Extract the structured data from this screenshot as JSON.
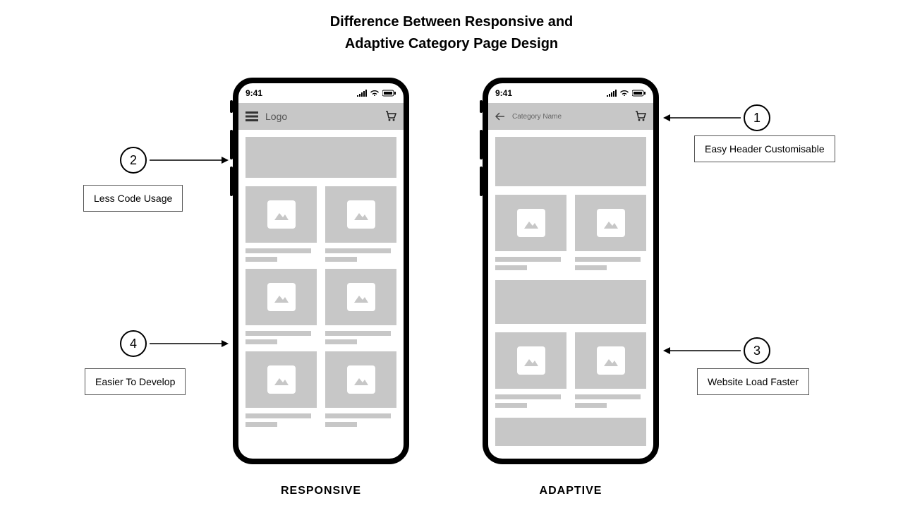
{
  "title_line1": "Difference Between Responsive and",
  "title_line2": "Adaptive Category Page Design",
  "phones": {
    "left": {
      "label": "RESPONSIVE",
      "time": "9:41",
      "header_text": "Logo"
    },
    "right": {
      "label": "ADAPTIVE",
      "time": "9:41",
      "header_text": "Category Name"
    }
  },
  "callouts": {
    "1": {
      "num": "1",
      "text": "Easy Header Customisable"
    },
    "2": {
      "num": "2",
      "text": "Less Code Usage"
    },
    "3": {
      "num": "3",
      "text": "Website Load Faster"
    },
    "4": {
      "num": "4",
      "text": "Easier To Develop"
    }
  }
}
